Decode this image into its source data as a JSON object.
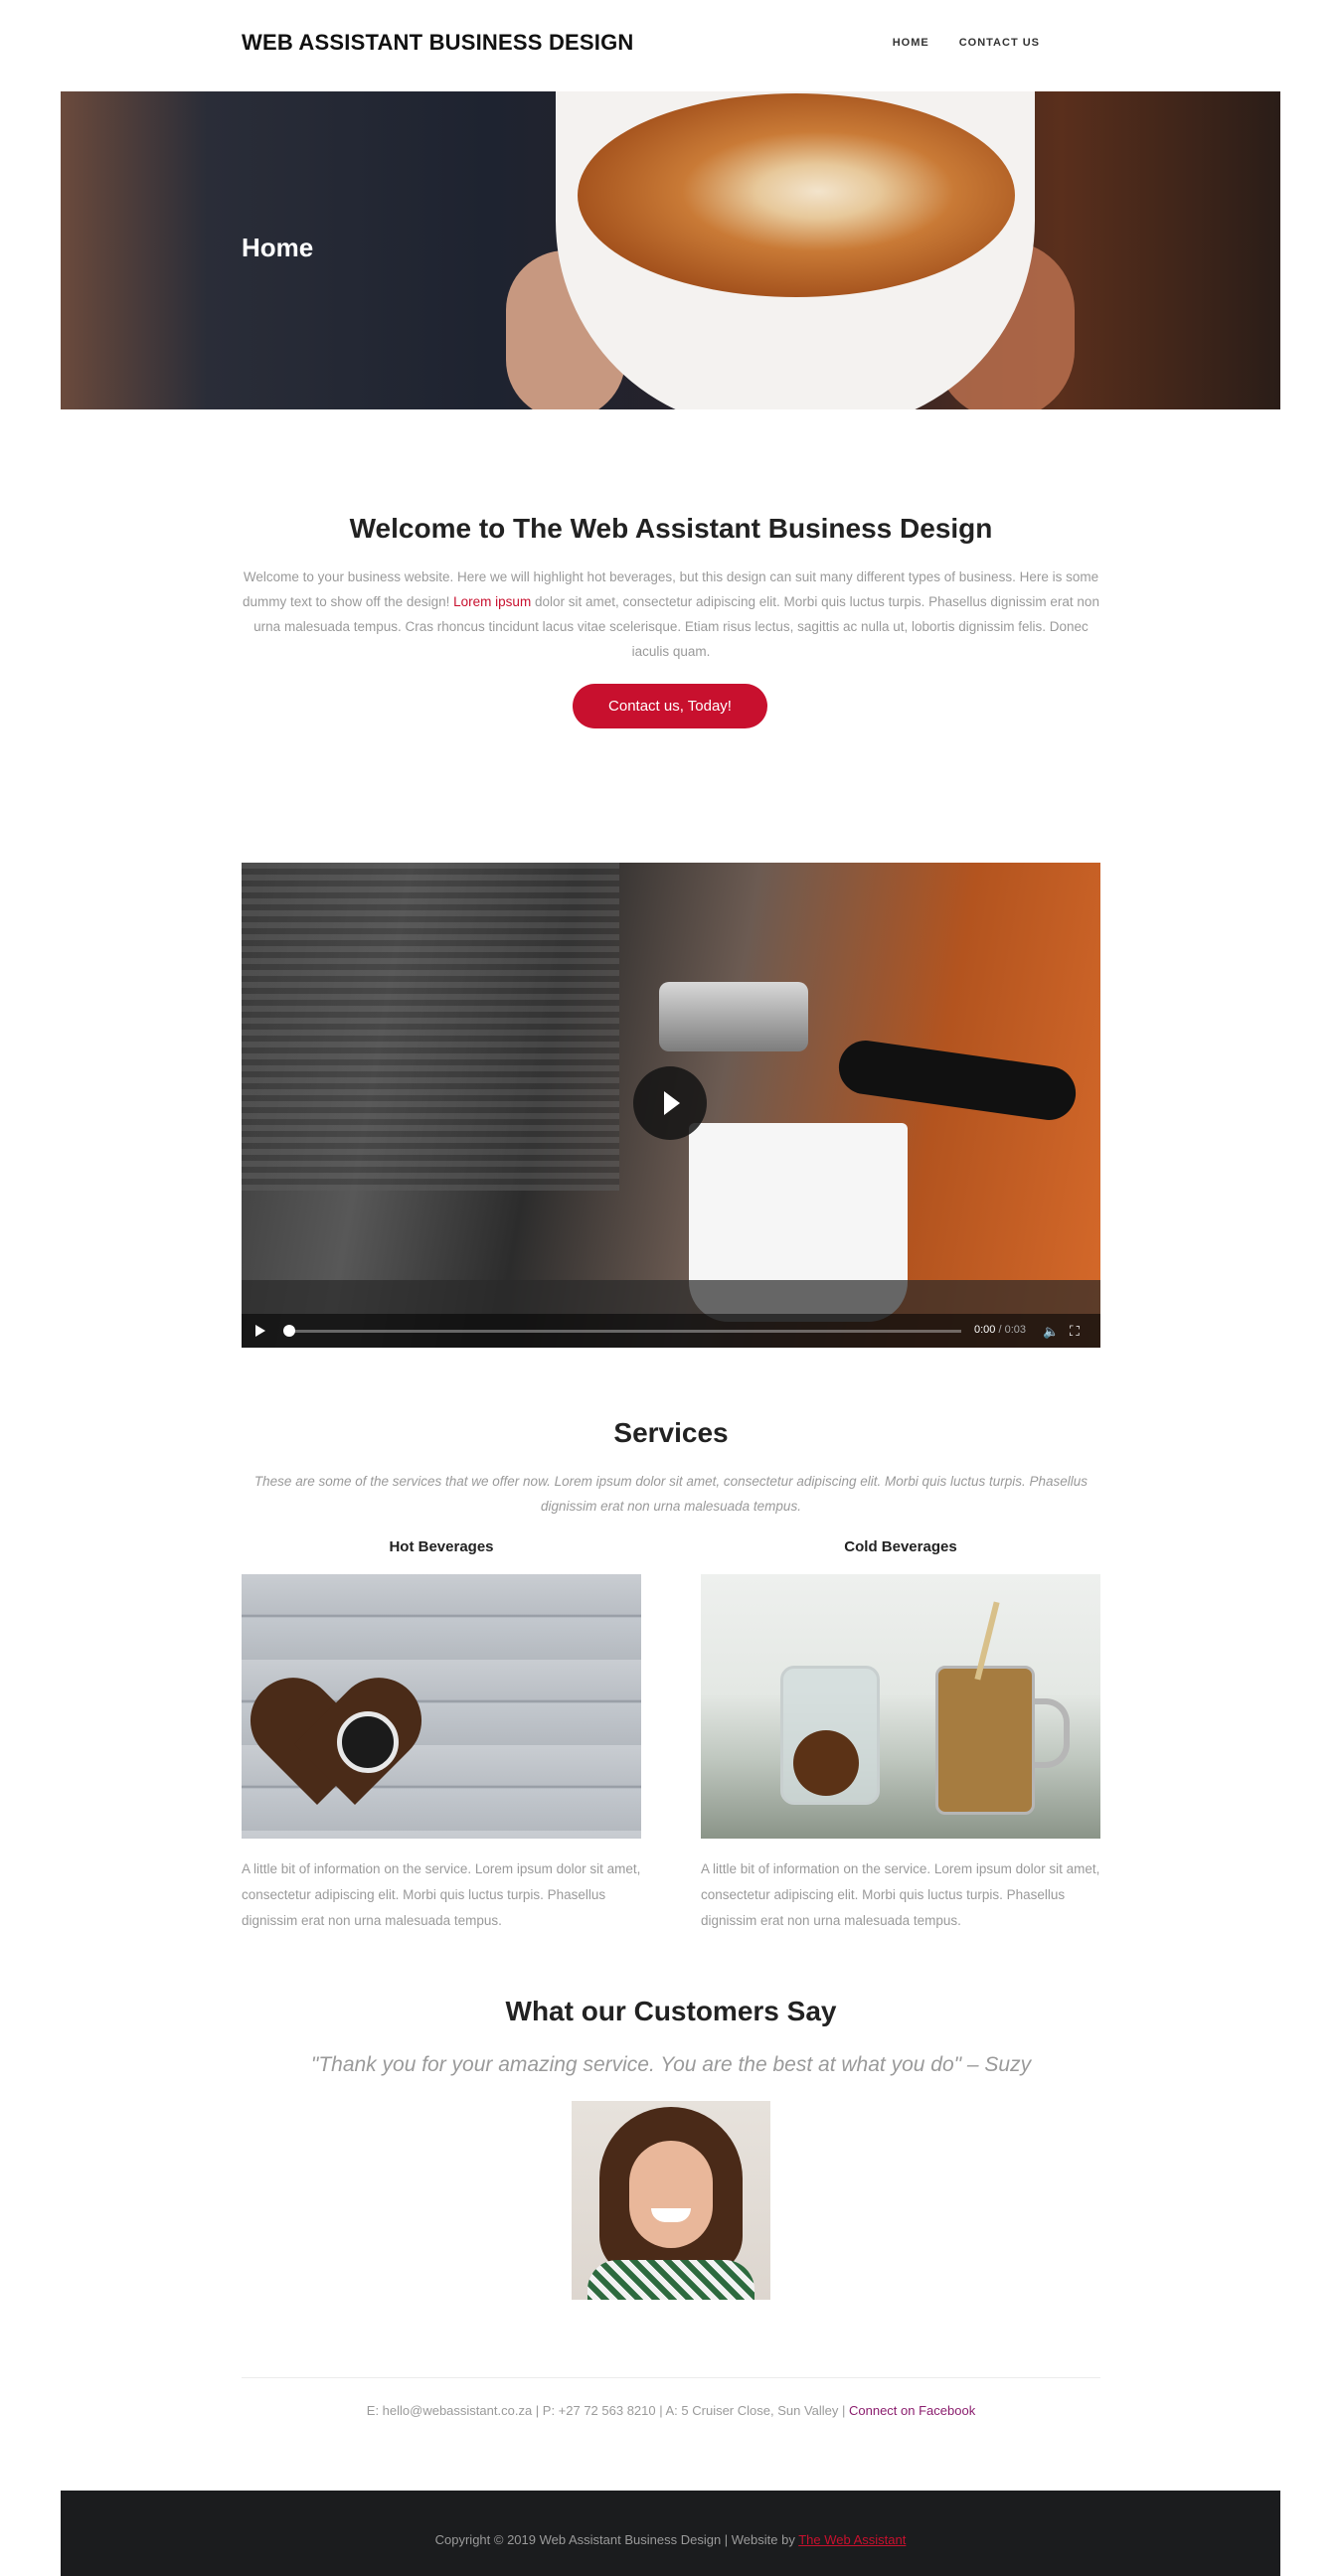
{
  "header": {
    "brand": "WEB ASSISTANT BUSINESS DESIGN",
    "nav": [
      "HOME",
      "CONTACT US"
    ]
  },
  "hero": {
    "title": "Home"
  },
  "welcome": {
    "title": "Welcome to The Web Assistant Business Design",
    "text_before": "Welcome to your business website. Here we will highlight hot beverages, but this design can suit many different types of business. Here is some dummy text to show off the design! ",
    "highlight": "Lorem ipsum",
    "text_after": " dolor sit amet, consectetur adipiscing elit. Morbi quis luctus turpis. Phasellus dignissim erat non urna malesuada tempus. Cras rhoncus tincidunt lacus vitae scelerisque. Etiam risus lectus, sagittis ac nulla ut, lobortis dignissim felis. Donec iaculis quam.",
    "cta_label": "Contact us, Today!"
  },
  "video": {
    "time_current": "0:00",
    "time_total": "/ 0:03"
  },
  "services": {
    "title": "Services",
    "intro": "These are some of the services that we offer now. Lorem ipsum dolor sit amet, consectetur adipiscing elit. Morbi quis luctus turpis. Phasellus dignissim erat non urna malesuada tempus.",
    "items": [
      {
        "title": "Hot Beverages",
        "text": "A little bit of information on the service. Lorem ipsum dolor sit amet, consectetur adipiscing elit. Morbi quis luctus turpis. Phasellus dignissim erat non urna malesuada tempus."
      },
      {
        "title": "Cold Beverages",
        "text": "A little bit of information on the service. Lorem ipsum dolor sit amet, consectetur adipiscing elit. Morbi quis luctus turpis. Phasellus dignissim erat non urna malesuada tempus."
      }
    ]
  },
  "testimonial": {
    "title": "What our Customers Say",
    "quote": "\"Thank you for your amazing service. You are the best at what you do\" – Suzy"
  },
  "contact": {
    "details": "E: hello@webassistant.co.za | P: +27 72 563 8210 | A: 5 Cruiser Close, Sun Valley | ",
    "facebook_label": "Connect on Facebook"
  },
  "footer": {
    "copyright": "Copyright © 2019 Web Assistant Business Design | Website by ",
    "credit_link": "The Web Assistant"
  },
  "colors": {
    "accent": "#c8102e",
    "footer_bg": "#1b1c1e",
    "body_text": "#9a9a9a"
  }
}
